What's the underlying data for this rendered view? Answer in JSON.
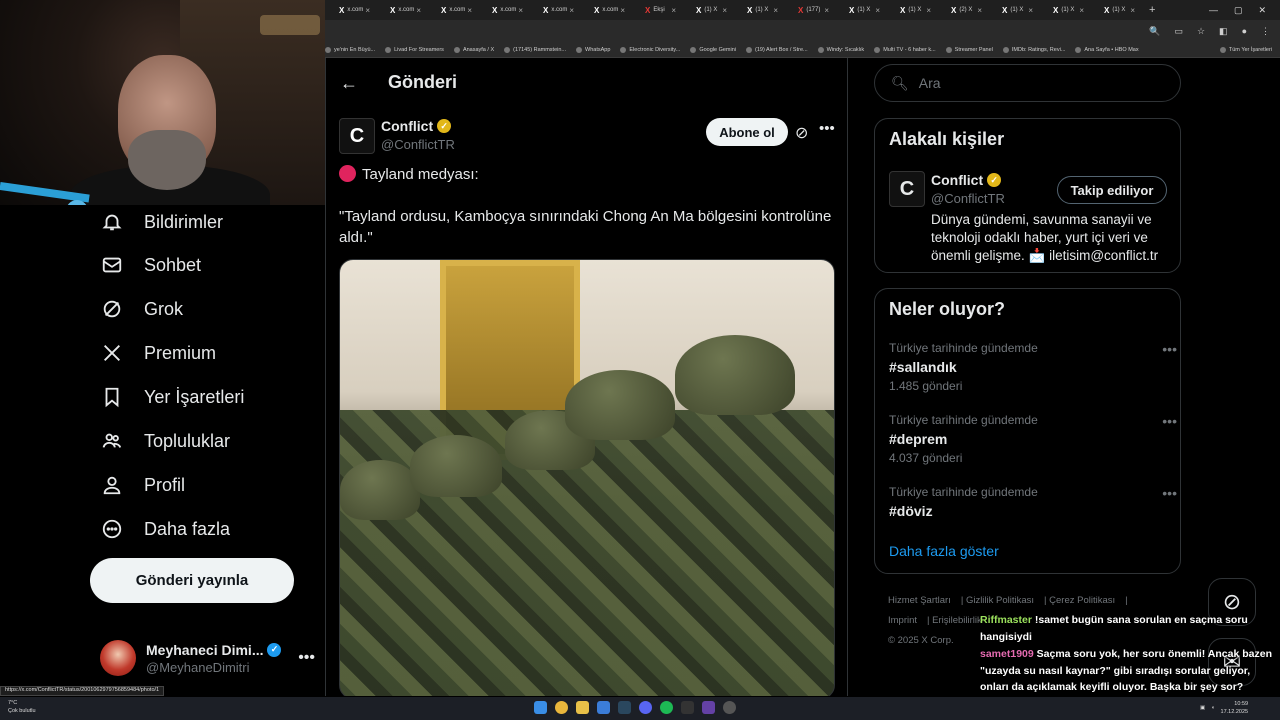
{
  "browser": {
    "tabs": [
      {
        "label": "x.com",
        "color": "#ffffff"
      },
      {
        "label": "x.com",
        "color": "#ffffff"
      },
      {
        "label": "x.com",
        "color": "#ffffff"
      },
      {
        "label": "x.com",
        "color": "#ffffff"
      },
      {
        "label": "x.com",
        "color": "#ffffff"
      },
      {
        "label": "x.com",
        "color": "#ffffff"
      },
      {
        "label": "Ekşi",
        "color": "#e53935"
      },
      {
        "label": "(1) X",
        "color": "#ffffff"
      },
      {
        "label": "(1) X",
        "color": "#ffffff"
      },
      {
        "label": "(177)",
        "color": "#e53935"
      },
      {
        "label": "(1) X",
        "color": "#ffffff"
      },
      {
        "label": "(1) X",
        "color": "#ffffff"
      },
      {
        "label": "(2) X",
        "color": "#ffffff"
      },
      {
        "label": "(1) X",
        "color": "#ffffff"
      },
      {
        "label": "(1) X",
        "color": "#ffffff"
      },
      {
        "label": "(1) X",
        "color": "#ffffff"
      }
    ],
    "bookmarks": [
      "ye'nin En Büyü...",
      "Livad For Streamers",
      "Anasayfa / X",
      "(17145) Rammstein...",
      "WhatsApp",
      "Electronic Diversity...",
      "Google Gemini",
      "(19) Alert Box / Stre...",
      "Windy: Sıcaklık",
      "Multi TV - 6 haber k...",
      "Streamer Panel",
      "IMDb: Ratings, Revi...",
      "Ana Sayfa • HBO Max"
    ],
    "bookmarks_all": "Tüm Yer İşaretleri",
    "status_url": "https://x.com/ConflictTR/status/2001062979756859484/photo/1"
  },
  "nav": {
    "items": [
      {
        "label": "Bildirimler",
        "icon": "bell-icon"
      },
      {
        "label": "Sohbet",
        "icon": "mail-icon"
      },
      {
        "label": "Grok",
        "icon": "grok-icon"
      },
      {
        "label": "Premium",
        "icon": "x-logo-icon"
      },
      {
        "label": "Yer İşaretleri",
        "icon": "bookmark-icon"
      },
      {
        "label": "Topluluklar",
        "icon": "communities-icon"
      },
      {
        "label": "Profil",
        "icon": "person-icon"
      },
      {
        "label": "Daha fazla",
        "icon": "more-circle-icon"
      }
    ],
    "post_button": "Gönderi yayınla",
    "profile": {
      "name": "Meyhaneci Dimi...",
      "handle": "@MeyhaneDimitri"
    }
  },
  "main": {
    "title": "Gönderi",
    "author": {
      "name": "Conflict",
      "handle": "@ConflictTR",
      "avatar_letter": "C"
    },
    "subscribe": "Abone ol",
    "text_line1": "Tayland medyası:",
    "text_quote": "\"Tayland ordusu, Kamboçya sınırındaki Chong An Ma bölgesini kontrolüne aldı.\""
  },
  "right": {
    "search_placeholder": "Ara",
    "related": {
      "title": "Alakalı kişiler",
      "name": "Conflict",
      "handle": "@ConflictTR",
      "follow": "Takip ediliyor",
      "bio": "Dünya gündemi, savunma sanayii ve teknoloji odaklı haber, yurt içi veri ve önemli gelişme. 📩 iletisim@conflict.tr"
    },
    "trends": {
      "title": "Neler oluyor?",
      "items": [
        {
          "context": "Türkiye tarihinde gündemde",
          "tag": "#sallandık",
          "count": "1.485 gönderi"
        },
        {
          "context": "Türkiye tarihinde gündemde",
          "tag": "#deprem",
          "count": "4.037 gönderi"
        },
        {
          "context": "Türkiye tarihinde gündemde",
          "tag": "#döviz",
          "count": ""
        }
      ],
      "show_more": "Daha fazla göster"
    },
    "footer": {
      "links": [
        "Hizmet Şartları",
        "Gizlilik Politikası",
        "Çerez Politikası",
        "Imprint",
        "Erişilebilirlik"
      ],
      "copyright": "© 2025 X Corp."
    }
  },
  "chat": [
    {
      "user": "Riffmaster",
      "msg": "!samet bugün sana sorulan en saçma soru hangisiydi"
    },
    {
      "user": "samet1909",
      "msg": "Saçma soru yok, her soru önemli! Ancak bazen \"uzayda su nasıl kaynar?\" gibi sıradışı sorular geliyor, onları da açıklamak keyifli oluyor. Başka bir şey sor? @Riffmaster"
    }
  ],
  "taskbar": {
    "weather_temp": "7°C",
    "weather_desc": "Çok bulutlu",
    "time": "10:59",
    "date": "17.12.2025"
  }
}
